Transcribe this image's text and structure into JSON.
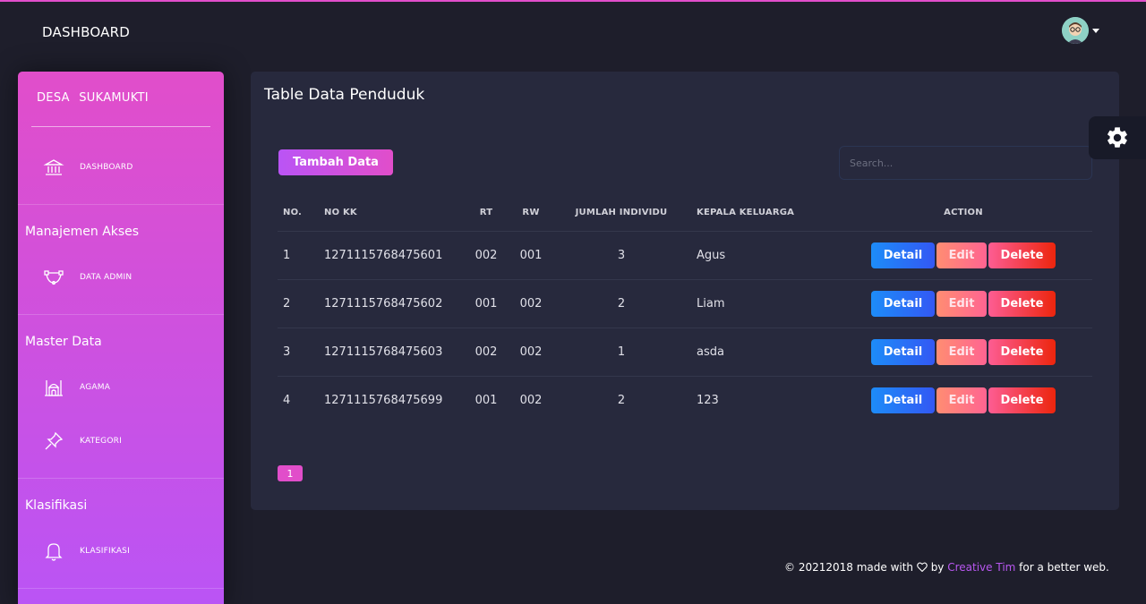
{
  "topbar": {
    "brand": "DASHBOARD"
  },
  "sidebar": {
    "logo": "DESA SUKAMUKTI",
    "items": [
      {
        "label": "DASHBOARD",
        "icon": "bank-icon"
      },
      {
        "label": "DATA ADMIN",
        "icon": "bezier-icon"
      },
      {
        "label": "AGAMA",
        "icon": "mosque-icon"
      },
      {
        "label": "KATEGORI",
        "icon": "pin-icon"
      },
      {
        "label": "KLASIFIKASI",
        "icon": "bell-icon"
      }
    ],
    "sections": [
      "Manajemen Akses",
      "Master Data",
      "Klasifikasi"
    ]
  },
  "main": {
    "title": "Table Data Penduduk",
    "add_button": "Tambah Data",
    "search_placeholder": "Search...",
    "columns": [
      "NO.",
      "NO KK",
      "RT",
      "RW",
      "JUMLAH INDIVIDU",
      "KEPALA KELUARGA",
      "ACTION"
    ],
    "rows": [
      [
        "1",
        "1271115768475601",
        "002",
        "001",
        "3",
        "Agus"
      ],
      [
        "2",
        "1271115768475602",
        "001",
        "002",
        "2",
        "Liam"
      ],
      [
        "3",
        "1271115768475603",
        "002",
        "002",
        "1",
        "asda"
      ],
      [
        "4",
        "1271115768475699",
        "001",
        "002",
        "2",
        "123"
      ]
    ],
    "actions": {
      "detail": "Detail",
      "edit": "Edit",
      "delete": "Delete"
    },
    "pagination": [
      "1"
    ]
  },
  "footer": {
    "prefix": "© 20212018 made with",
    "by": "by",
    "link": "Creative Tim",
    "suffix": "for a better web."
  },
  "colors": {
    "primary": "#e14eca",
    "accent": "#ba54f5",
    "info": "#1d8cf8",
    "danger": "#fd5d93",
    "card": "#27293d",
    "background": "#1e1e2b"
  }
}
